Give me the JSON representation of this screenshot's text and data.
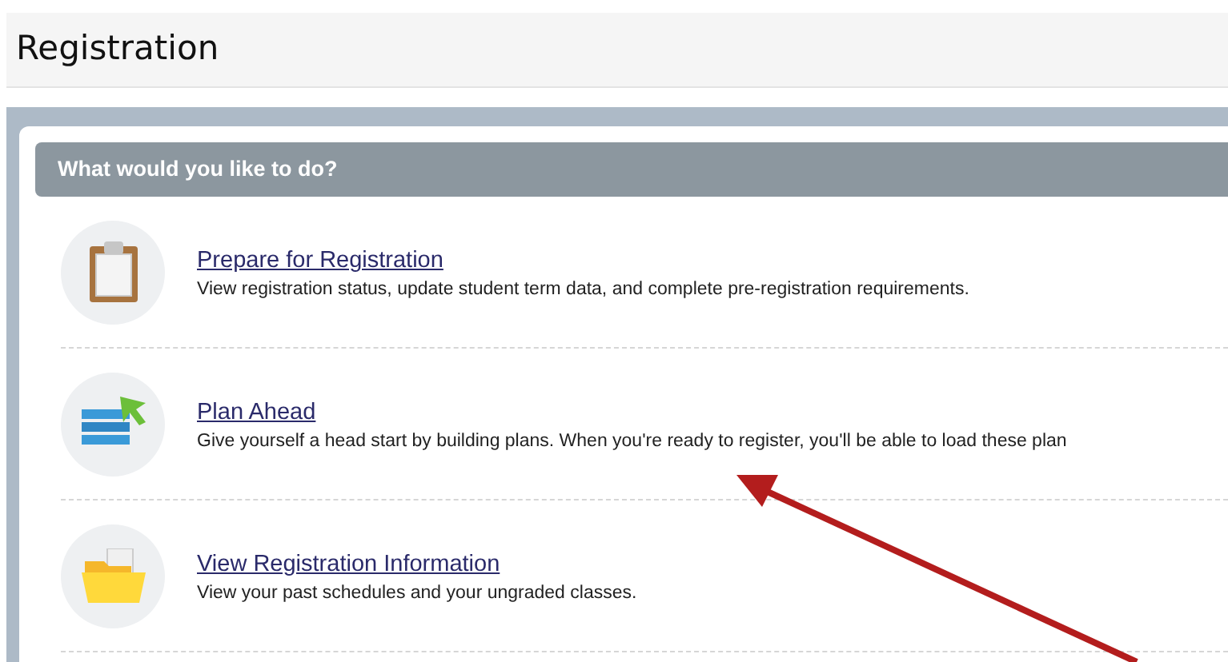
{
  "page_title": "Registration",
  "panel": {
    "heading": "What would you like to do?",
    "items": [
      {
        "kind": "clipboard",
        "title": "Prepare for Registration",
        "description": "View registration status, update student term data, and complete pre-registration requirements."
      },
      {
        "kind": "plan",
        "title": "Plan Ahead",
        "description": "Give yourself a head start by building plans. When you're ready to register, you'll be able to load these plan"
      },
      {
        "kind": "folder",
        "title": "View Registration Information",
        "description": "View your past schedules and your ungraded classes."
      }
    ]
  }
}
